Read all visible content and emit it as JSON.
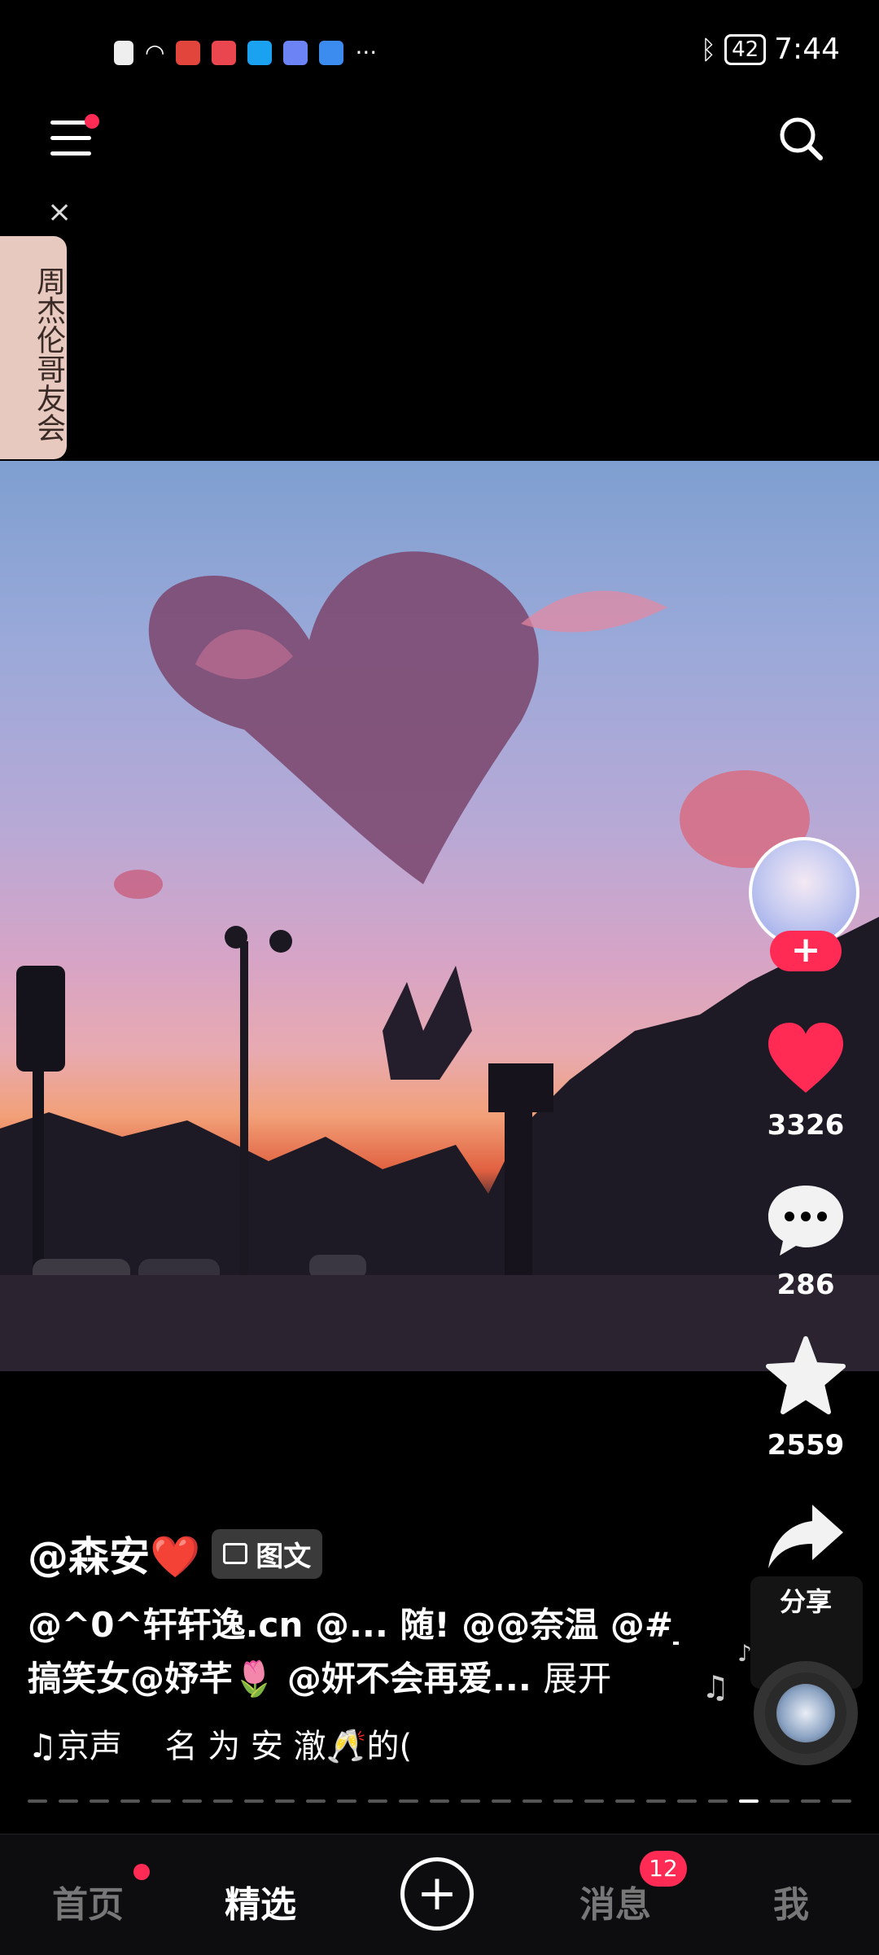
{
  "status_bar": {
    "battery": "42",
    "time": "7:44",
    "more": "···"
  },
  "side_tag": {
    "text": "周杰伦哥友会"
  },
  "close_symbol": "×",
  "rail": {
    "likes": "3326",
    "comments": "286",
    "favorites": "2559",
    "share_label": "分享",
    "follow_symbol": "+"
  },
  "post": {
    "author": "@森安❤️",
    "tag_label": "图文",
    "caption_line1": "@^0^轩轩逸.cn @... 随! @@奈温 @#_",
    "caption_line2": "搞笑女@妤芊🌷 @妍不会再爱...",
    "expand_label": "展开",
    "music_text": "♫京声　 名 为 安 澈🥂的("
  },
  "progress": {
    "total": 27,
    "active_index": 23
  },
  "nav": {
    "home": "首页",
    "featured": "精选",
    "plus": "+",
    "messages": "消息",
    "messages_badge": "12",
    "me": "我"
  },
  "colors": {
    "accent": "#ff2b55",
    "heart": "#ff2b55",
    "background": "#000000"
  }
}
